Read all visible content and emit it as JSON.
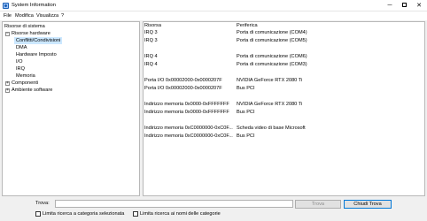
{
  "window": {
    "title": "System Information",
    "minimize_glyph": "─",
    "close_glyph": "✕"
  },
  "menu": {
    "items": [
      "File",
      "Modifica",
      "Visualizza",
      "?"
    ]
  },
  "tree": {
    "items": [
      {
        "label": "Risorse di sistema",
        "expander": "",
        "selected": false
      },
      {
        "label": "Risorse hardware",
        "expander": "−",
        "selected": false
      },
      {
        "label": "Conflitti/Condivisioni",
        "expander": "",
        "selected": true
      },
      {
        "label": "DMA",
        "expander": "",
        "selected": false
      },
      {
        "label": "Hardware Imposto",
        "expander": "",
        "selected": false
      },
      {
        "label": "I/O",
        "expander": "",
        "selected": false
      },
      {
        "label": "IRQ",
        "expander": "",
        "selected": false
      },
      {
        "label": "Memoria",
        "expander": "",
        "selected": false
      },
      {
        "label": "Componenti",
        "expander": "+",
        "selected": false
      },
      {
        "label": "Ambiente software",
        "expander": "+",
        "selected": false
      }
    ]
  },
  "list": {
    "columns": [
      "Risorsa",
      "Periferica"
    ],
    "rows": [
      {
        "resource": "IRQ 3",
        "device": "Porta di comunicazione (COM4)"
      },
      {
        "resource": "IRQ 3",
        "device": "Porta di comunicazione (COM5)"
      },
      {
        "resource": "",
        "device": ""
      },
      {
        "resource": "IRQ 4",
        "device": "Porta di comunicazione (COM6)"
      },
      {
        "resource": "IRQ 4",
        "device": "Porta di comunicazione (COM3)"
      },
      {
        "resource": "",
        "device": ""
      },
      {
        "resource": "Porta I/O 0x00002000-0x0000207F",
        "device": "NVIDIA GeForce RTX 2080 Ti"
      },
      {
        "resource": "Porta I/O 0x00002000-0x0000207F",
        "device": "Bus PCI"
      },
      {
        "resource": "",
        "device": ""
      },
      {
        "resource": "Indirizzo memoria 0x0000-0xFFFFFFF",
        "device": "NVIDIA GeForce RTX 2080 Ti"
      },
      {
        "resource": "Indirizzo memoria 0x0000-0xFFFFFFF",
        "device": "Bus PCI"
      },
      {
        "resource": "",
        "device": ""
      },
      {
        "resource": "Indirizzo memoria 0xC0000000-0xC0F...",
        "device": "Scheda video di base Microsoft"
      },
      {
        "resource": "Indirizzo memoria 0xC0000000-0xC0F...",
        "device": "Bus PCI"
      }
    ]
  },
  "find": {
    "label": "Trova:",
    "value": "",
    "find_button": "Trova",
    "close_button": "Chiudi Trova",
    "checkbox_category": "Limita ricerca a categoria selezionata",
    "checkbox_names": "Limita ricerca ai nomi delle categorie"
  }
}
